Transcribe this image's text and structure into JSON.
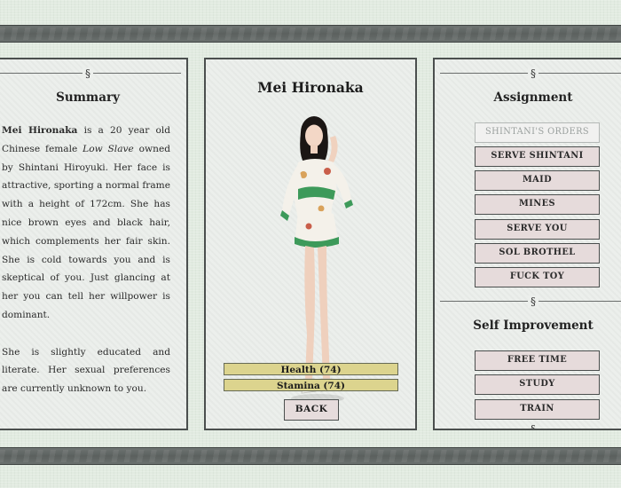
{
  "summary": {
    "heading": "Summary",
    "section_mark": "§",
    "p1": {
      "name": "Mei Hironaka",
      "t1": " is a 20 year old Chinese female ",
      "slave_type": "Low Slave",
      "t2": " owned by Shintani Hiroyuki. Her face is attractive, sporting a normal frame with a height of 172cm. She has nice brown eyes and black hair, which complements her fair skin. She is cold towards you and is skeptical of you. Just glancing at her you can tell her willpower is dominant."
    },
    "p2": "She is slightly educated and literate. Her sexual preferences are currently unknown to you."
  },
  "character": {
    "name": "Mei Hironaka",
    "health_label": "Health (74)",
    "health": 74,
    "stamina_label": "Stamina (74)",
    "stamina": 74,
    "back_label": "BACK"
  },
  "assignment": {
    "section_mark": "§",
    "heading": "Assignment",
    "orders_label": "SHINTANI'S ORDERS",
    "buttons": [
      "SERVE SHINTANI",
      "MAID",
      "MINES",
      "SERVE YOU",
      "SOL BROTHEL",
      "FUCK TOY"
    ]
  },
  "self_improvement": {
    "section_mark": "§",
    "heading": "Self Improvement",
    "buttons": [
      "FREE TIME",
      "STUDY",
      "TRAIN"
    ],
    "bottom_mark": "§"
  },
  "colors": {
    "background": "#e2ebe1",
    "band": "#5e6462",
    "panel": "#ecefec",
    "stat_bar": "#dcd48e",
    "button": "#e6dbdb"
  }
}
